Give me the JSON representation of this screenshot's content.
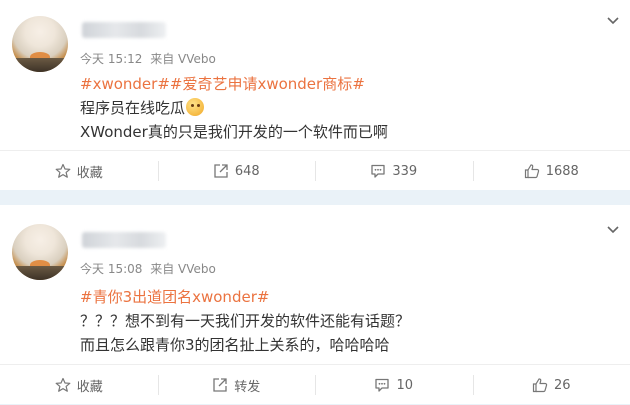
{
  "posts": [
    {
      "meta": {
        "time": "今天 15:12",
        "source": "来自 VVebo"
      },
      "lines": [
        {
          "hashtags": [
            "#xwonder#",
            "#爱奇艺申请xwonder商标#"
          ]
        },
        {
          "text": "程序员在线吃瓜"
        },
        {
          "text": "XWonder真的只是我们开发的一个软件而已啊"
        }
      ],
      "actions": {
        "favorite": "收藏",
        "repost": "648",
        "comment": "339",
        "like": "1688"
      }
    },
    {
      "meta": {
        "time": "今天 15:08",
        "source": "来自 VVebo"
      },
      "lines": [
        {
          "hashtags": [
            "#青你3出道团名xwonder#"
          ]
        },
        {
          "text": "？？？想不到有一天我们开发的软件还能有话题？"
        },
        {
          "text": "而且怎么跟青你3的团名扯上关系的，哈哈哈哈"
        }
      ],
      "actions": {
        "favorite": "收藏",
        "repost": "转发",
        "comment": "10",
        "like": "26"
      }
    }
  ],
  "icons": [
    "chevron-down-icon",
    "star-icon",
    "share-icon",
    "comment-icon",
    "thumbs-up-icon"
  ],
  "colors": {
    "hashtag": "#eb7340",
    "background": "#eaf2f8",
    "card": "#ffffff"
  }
}
